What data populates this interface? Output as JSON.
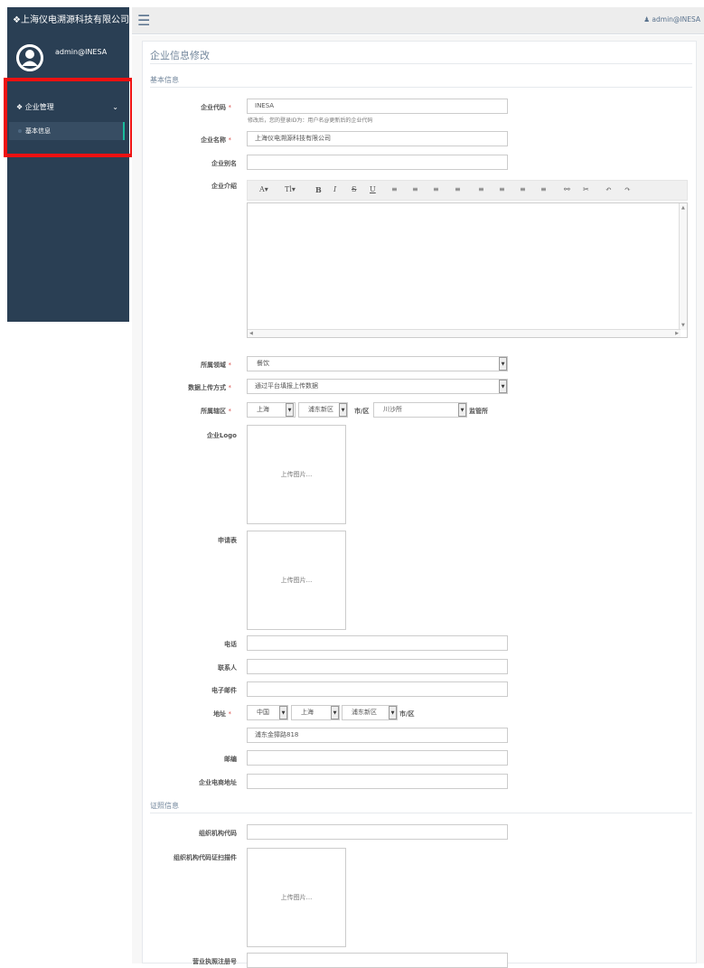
{
  "app": {
    "brand": "上海仪电溯源科技有限公司"
  },
  "user": {
    "name": "admin@INESA",
    "topbar_name": "admin@INESA"
  },
  "sidebar": {
    "group_label": "企业管理",
    "items": [
      {
        "label": "基本信息"
      }
    ]
  },
  "page": {
    "title": "企业信息修改"
  },
  "sections": {
    "basic": "基本信息",
    "cert": "证照信息"
  },
  "form": {
    "code": {
      "label": "企业代码",
      "value": "INESA",
      "hint": "修改后，您的登录ID为：用户名@更新后的企业代码"
    },
    "name": {
      "label": "企业名称",
      "value": "上海仪电溯源科技有限公司"
    },
    "alias": {
      "label": "企业别名",
      "value": ""
    },
    "intro": {
      "label": "企业介绍"
    },
    "domain": {
      "label": "所属领域",
      "value": "餐饮"
    },
    "upload_method": {
      "label": "数据上传方式",
      "value": "通过平台填报上传数据"
    },
    "jurisdiction": {
      "label": "所属辖区",
      "city": "上海",
      "district": "浦东新区",
      "district_unit": "市/区",
      "office": "川沙所",
      "office_unit": "监管所"
    },
    "logo": {
      "label": "企业Logo",
      "upload_text": "上传图片..."
    },
    "application": {
      "label": "申请表",
      "upload_text": "上传图片..."
    },
    "phone": {
      "label": "电话",
      "value": ""
    },
    "contact": {
      "label": "联系人",
      "value": ""
    },
    "email": {
      "label": "电子邮件",
      "value": ""
    },
    "address": {
      "label": "地址",
      "country": "中国",
      "province": "上海",
      "district": "浦东新区",
      "district_unit": "市/区",
      "street": "浦东金獐路818"
    },
    "zip": {
      "label": "邮编",
      "value": ""
    },
    "ecommerce": {
      "label": "企业电商地址",
      "value": ""
    },
    "org_code": {
      "label": "组织机构代码",
      "value": ""
    },
    "org_scan": {
      "label": "组织机构代码证扫描件",
      "upload_text": "上传图片..."
    },
    "license": {
      "label": "营业执照注册号",
      "value": ""
    }
  },
  "required_mark": "*",
  "toolbar": {
    "font": "A",
    "size": "T",
    "bold": "B",
    "italic": "I",
    "strike": "S",
    "underline": "U",
    "undo": "↶",
    "redo": "↷"
  },
  "icons": {
    "brand": "leaf-icon",
    "menu": "hamburger-icon",
    "user": "user-icon",
    "chevron": "chevron-down-icon"
  },
  "colors": {
    "sidebar": "#2a3f54",
    "highlight": "#ee1111",
    "accent": "#1abb9c"
  }
}
